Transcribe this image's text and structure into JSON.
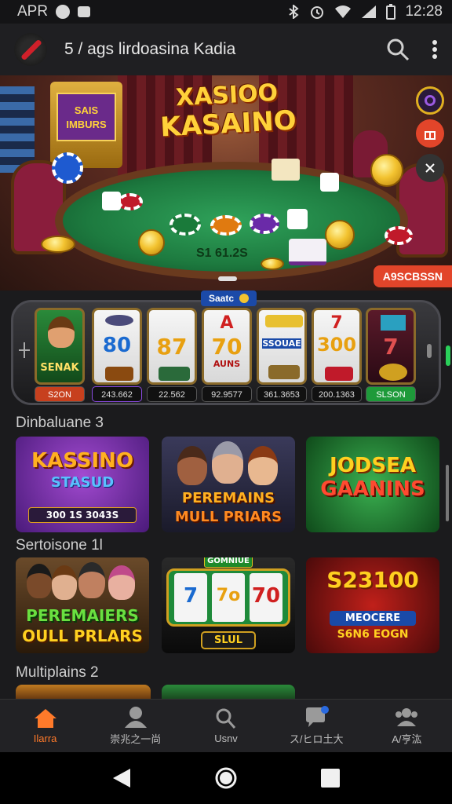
{
  "status_bar": {
    "carrier": "APR",
    "time": "12:28"
  },
  "app_bar": {
    "title": "5 / ags lirdoasina Kadia"
  },
  "hero": {
    "title_line1": "XASIOO",
    "title_line2": "KASAINO",
    "table_amount": "S1 61.2S",
    "badge": "A9SCBSSN",
    "machine_text": "SAIS IMBURS"
  },
  "slots_strip": {
    "tag": "Saatc",
    "reels": [
      {
        "symbol": "SENAK",
        "label": "S2ON",
        "label_color": "#c7401e"
      },
      {
        "symbol": "80",
        "label": "243.662",
        "label_color": "#111111"
      },
      {
        "symbol": "87",
        "label": "22.562",
        "label_color": "#111111"
      },
      {
        "symbol": "70",
        "sub": "AUNS",
        "label": "92.9577",
        "label_color": "#111111"
      },
      {
        "symbol": "SSOUAE",
        "label": "361.3653",
        "label_color": "#111111"
      },
      {
        "symbol": "300",
        "label": "200.1363",
        "label_color": "#111111"
      },
      {
        "symbol": "7",
        "label": "SLSON",
        "label_color": "#1e9a3a"
      }
    ]
  },
  "sections": [
    {
      "title": "Dinbaluane 3",
      "cards": [
        {
          "line1": "KASSINO",
          "line2": "STASUD",
          "line3": "300 1S  3043S",
          "theme": "purple"
        },
        {
          "line1": "PEREMAINS",
          "line2": "MULL PRIARS",
          "theme": "dark"
        },
        {
          "line1": "JODSEA",
          "line2": "GAANINS",
          "theme": "green"
        }
      ]
    },
    {
      "title": "Sertoisone 1l",
      "cards": [
        {
          "line1": "PEREMAIERS",
          "line2": "OULL PRLARS",
          "theme": "crowd"
        },
        {
          "line1": "GOMNIUE",
          "reels": [
            "7",
            "7o",
            "70"
          ],
          "line2": "SLUL",
          "theme": "slot"
        },
        {
          "line1": "S23100",
          "line2": "MEOCERE",
          "line3": "S6N6 EOGN",
          "theme": "red"
        }
      ]
    },
    {
      "title": "Multiplains 2"
    }
  ],
  "bottom_nav": [
    {
      "label": "Ilarra",
      "icon": "home-icon",
      "active": true
    },
    {
      "label": "崇兆之一尚",
      "icon": "profile-icon",
      "active": false
    },
    {
      "label": "Usnv",
      "icon": "search-icon",
      "active": false
    },
    {
      "label": "ス/ヒロ土大",
      "icon": "chat-icon",
      "active": false
    },
    {
      "label": "A/亨汯",
      "icon": "group-icon",
      "active": false
    }
  ],
  "colors": {
    "accent": "#ff7a2a",
    "background": "#1b1b1d",
    "felt": "#1d7a3f"
  }
}
